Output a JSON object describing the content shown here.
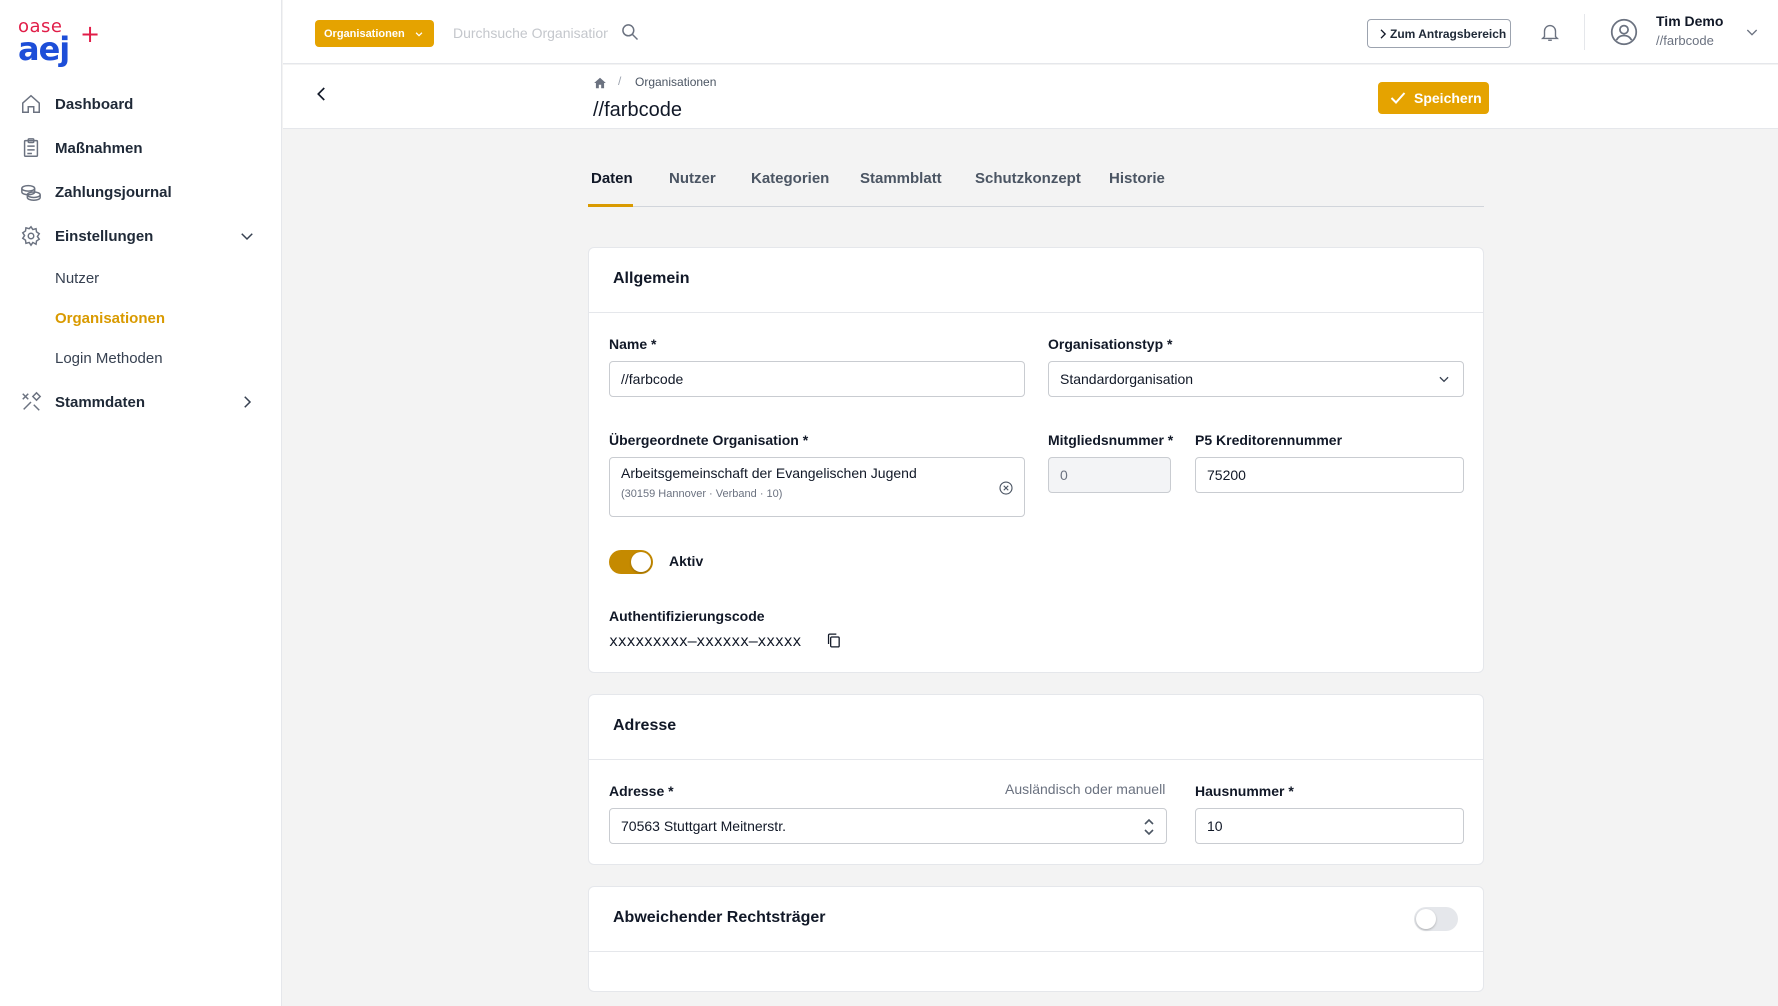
{
  "logo": {
    "top_text": "oase",
    "main_text": "aej",
    "cross": "+"
  },
  "sidebar": {
    "items": [
      {
        "label": "Dashboard",
        "icon": "home-icon"
      },
      {
        "label": "Maßnahmen",
        "icon": "clipboard-icon"
      },
      {
        "label": "Zahlungsjournal",
        "icon": "coins-icon"
      },
      {
        "label": "Einstellungen",
        "icon": "gear-icon",
        "expanded": true
      },
      {
        "label": "Stammdaten",
        "icon": "tools-icon",
        "expanded": false
      }
    ],
    "subitems": [
      {
        "label": "Nutzer",
        "active": false
      },
      {
        "label": "Organisationen",
        "active": true
      },
      {
        "label": "Login Methoden",
        "active": false
      }
    ]
  },
  "topbar": {
    "org_dropdown": "Organisationen",
    "search_placeholder": "Durchsuche Organisationen",
    "antrag_button": "Zum Antragsbereich",
    "user_name": "Tim Demo",
    "user_org": "//farbcode"
  },
  "pagehead": {
    "breadcrumb": "Organisationen",
    "title": "//farbcode",
    "save_label": "Speichern"
  },
  "tabs": [
    "Daten",
    "Nutzer",
    "Kategorien",
    "Stammblatt",
    "Schutzkonzept",
    "Historie"
  ],
  "active_tab": "Daten",
  "allgemein": {
    "title": "Allgemein",
    "name_label": "Name *",
    "name_value": "//farbcode",
    "typ_label": "Organisationstyp *",
    "typ_value": "Standardorganisation",
    "parent_label": "Übergeordnete Organisation *",
    "parent_value": "Arbeitsgemeinschaft der Evangelischen Jugend",
    "parent_sub": "(30159 Hannover · Verband · 10)",
    "mitglied_label": "Mitgliedsnummer *",
    "mitglied_value": "0",
    "kreditor_label": "P5 Kreditorennummer",
    "kreditor_value": "75200",
    "aktiv_label": "Aktiv",
    "aktiv": true,
    "auth_label": "Authentifizierungscode",
    "auth_value": "xxxxxxxxx–xxxxxx–xxxxx"
  },
  "adresse": {
    "title": "Adresse",
    "adresse_label": "Adresse *",
    "manual_link": "Ausländisch oder manuell",
    "adresse_value": "70563 Stuttgart Meitnerstr.",
    "hausnr_label": "Hausnummer *",
    "hausnr_value": "10"
  },
  "rechtstraeger": {
    "title": "Abweichender Rechtsträger",
    "enabled": false
  },
  "colors": {
    "accent": "#e5a300",
    "toggle_on": "#c58a00",
    "logo_blue": "#1d4ed8",
    "logo_red": "#e11d48"
  }
}
